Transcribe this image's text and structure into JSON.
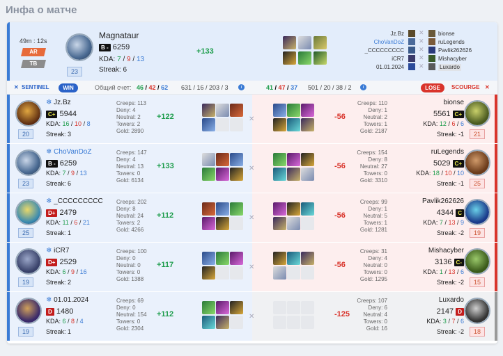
{
  "title": "Инфа о матче",
  "header": {
    "duration": "49m : 12s",
    "mode1": "AR",
    "mode2": "TB",
    "player_name": "Magnataur",
    "rank": "B -",
    "rating": "6259",
    "kda_label": "KDA:",
    "kills": "7",
    "deaths": "9",
    "assists": "13",
    "streak": "Streak: 6",
    "level": "23",
    "diff": "+133",
    "opponents_left": [
      "Jz.Bz",
      "ChoVanDoZ",
      "_CCCCCCCCC",
      "iCR7",
      "01.01.2024"
    ],
    "opponents_right": [
      "bionse",
      "ruLegends",
      "Pavlik262626",
      "Mishacyber",
      "Luxardo"
    ]
  },
  "teams": {
    "left_label": "SENTINEL",
    "win": "WIN",
    "score_label": "Общий счет:",
    "score_a": "46",
    "score_b": "42",
    "score_c": "62",
    "left_totals": "631 / 16 / 203 / 3",
    "right_a": "41",
    "right_b": "47",
    "right_c": "37",
    "right_totals": "501 / 20 / 38 / 2",
    "lose": "LOSE",
    "right_label": "SCOURGE"
  },
  "rows": [
    {
      "l": {
        "name": "Jz.Bz",
        "rank": "C+",
        "rating": "5944",
        "k": "16",
        "d": "10",
        "a": "8",
        "streak": "Streak: 3",
        "level": "20",
        "creeps": "Creeps: 113",
        "deny": "Deny: 4",
        "neutral": "Neutral: 2",
        "towers": "Towers: 2",
        "gold": "Gold: 2890",
        "diff": "+122"
      },
      "r": {
        "name": "bionse",
        "rank": "C+",
        "rating": "5561",
        "k": "12",
        "d": "6",
        "a": "6",
        "streak": "Streak: -1",
        "level": "21",
        "creeps": "Creeps: 110",
        "deny": "Deny: 1",
        "neutral": "Neutral: 2",
        "towers": "Towers: 1",
        "gold": "Gold: 2187",
        "diff": "-56"
      }
    },
    {
      "l": {
        "name": "ChoVanDoZ",
        "rank": "B -",
        "rating": "6259",
        "k": "7",
        "d": "9",
        "a": "13",
        "streak": "Streak: 6",
        "level": "23",
        "creeps": "Creeps: 147",
        "deny": "Deny: 4",
        "neutral": "Neutral: 13",
        "towers": "Towers: 0",
        "gold": "Gold: 6134",
        "diff": "+133"
      },
      "r": {
        "name": "ruLegends",
        "rank": "C+",
        "rating": "5029",
        "k": "18",
        "d": "10",
        "a": "10",
        "streak": "Streak: -1",
        "level": "25",
        "creeps": "Creeps: 154",
        "deny": "Deny: 8",
        "neutral": "Neutral: 27",
        "towers": "Towers: 0",
        "gold": "Gold: 3310",
        "diff": "-56"
      }
    },
    {
      "l": {
        "name": "_CCCCCCCCC",
        "rank": "D+",
        "rating": "2479",
        "k": "11",
        "d": "6",
        "a": "21",
        "streak": "Streak: 1",
        "level": "25",
        "creeps": "Creeps: 202",
        "deny": "Deny: 8",
        "neutral": "Neutral: 24",
        "towers": "Towers: 2",
        "gold": "Gold: 4266",
        "diff": "+112"
      },
      "r": {
        "name": "Pavlik262626",
        "rank": "C",
        "rating": "4344",
        "k": "7",
        "d": "13",
        "a": "9",
        "streak": "Streak: -2",
        "level": "19",
        "creeps": "Creeps: 99",
        "deny": "Deny: 1",
        "neutral": "Neutral: 5",
        "towers": "Towers: 1",
        "gold": "Gold: 1281",
        "diff": "-56"
      }
    },
    {
      "l": {
        "name": "iCR7",
        "rank": "D+",
        "rating": "2529",
        "k": "6",
        "d": "9",
        "a": "16",
        "streak": "Streak: 2",
        "level": "19",
        "creeps": "Creeps: 100",
        "deny": "Deny: 0",
        "neutral": "Neutral: 0",
        "towers": "Towers: 0",
        "gold": "Gold: 1388",
        "diff": "+117"
      },
      "r": {
        "name": "Mishacyber",
        "rank": "C-",
        "rating": "3136",
        "k": "1",
        "d": "13",
        "a": "6",
        "streak": "Streak: -2",
        "level": "15",
        "creeps": "Creeps: 31",
        "deny": "Deny: 4",
        "neutral": "Neutral: 0",
        "towers": "Towers: 0",
        "gold": "Gold: 1295",
        "diff": "-56"
      }
    },
    {
      "l": {
        "name": "01.01.2024",
        "rank": "D",
        "rating": "1480",
        "k": "6",
        "d": "8",
        "a": "4",
        "streak": "Streak: 1",
        "level": "19",
        "creeps": "Creeps: 69",
        "deny": "Deny: 0",
        "neutral": "Neutral: 154",
        "towers": "Towers: 0",
        "gold": "Gold: 2304",
        "diff": "+112"
      },
      "r": {
        "name": "Luxardo",
        "rank": "D",
        "rating": "2147",
        "k": "3",
        "d": "7",
        "a": "6",
        "streak": "Streak: -2",
        "level": "18",
        "creeps": "Creeps: 107",
        "deny": "Deny: 6",
        "neutral": "Neutral: 4",
        "towers": "Towers: 0",
        "gold": "Gold: 16",
        "diff": "-125"
      }
    }
  ],
  "colors": {
    "accent": "#3a7bd5",
    "win": "#2a62c8",
    "lose": "#d9342b",
    "positive": "#1e9d4c"
  }
}
